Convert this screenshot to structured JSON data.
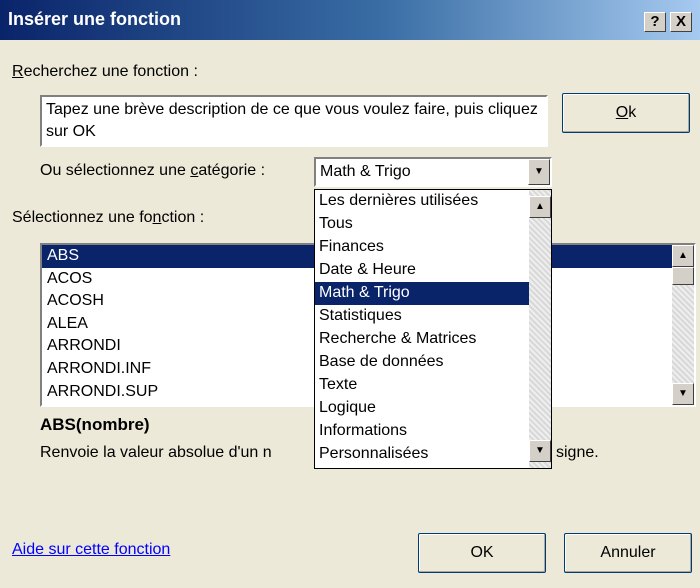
{
  "titlebar": {
    "title": "Insérer une fonction",
    "help_btn": "?",
    "close_btn": "X"
  },
  "search": {
    "label_prefix": "R",
    "label_rest": "echerchez une fonction :",
    "description": "Tapez une brève description de ce que vous voulez faire, puis cliquez sur OK",
    "ok_prefix": "",
    "ok_access": "O",
    "ok_rest": "k"
  },
  "category": {
    "label_a": "Ou sélectionnez une ",
    "label_u": "c",
    "label_b": "atégorie :",
    "selected": "Math & Trigo",
    "options": [
      "Les dernières utilisées",
      "Tous",
      "Finances",
      "Date & Heure",
      "Math & Trigo",
      "Statistiques",
      "Recherche & Matrices",
      "Base de données",
      "Texte",
      "Logique",
      "Informations",
      "Personnalisées"
    ],
    "highlighted_index": 4
  },
  "functions": {
    "label_a": "Sélectionnez une fo",
    "label_u": "n",
    "label_b": "ction :",
    "items": [
      "ABS",
      "ACOS",
      "ACOSH",
      "ALEA",
      "ARRONDI",
      "ARRONDI.INF",
      "ARRONDI.SUP"
    ],
    "selected_index": 0
  },
  "details": {
    "signature": "ABS(nombre)",
    "text_left": "Renvoie la valeur absolue d'un n",
    "text_right": "signe."
  },
  "footer": {
    "help_link": "Aide sur cette fonction",
    "ok": "OK",
    "cancel": "Annuler"
  }
}
